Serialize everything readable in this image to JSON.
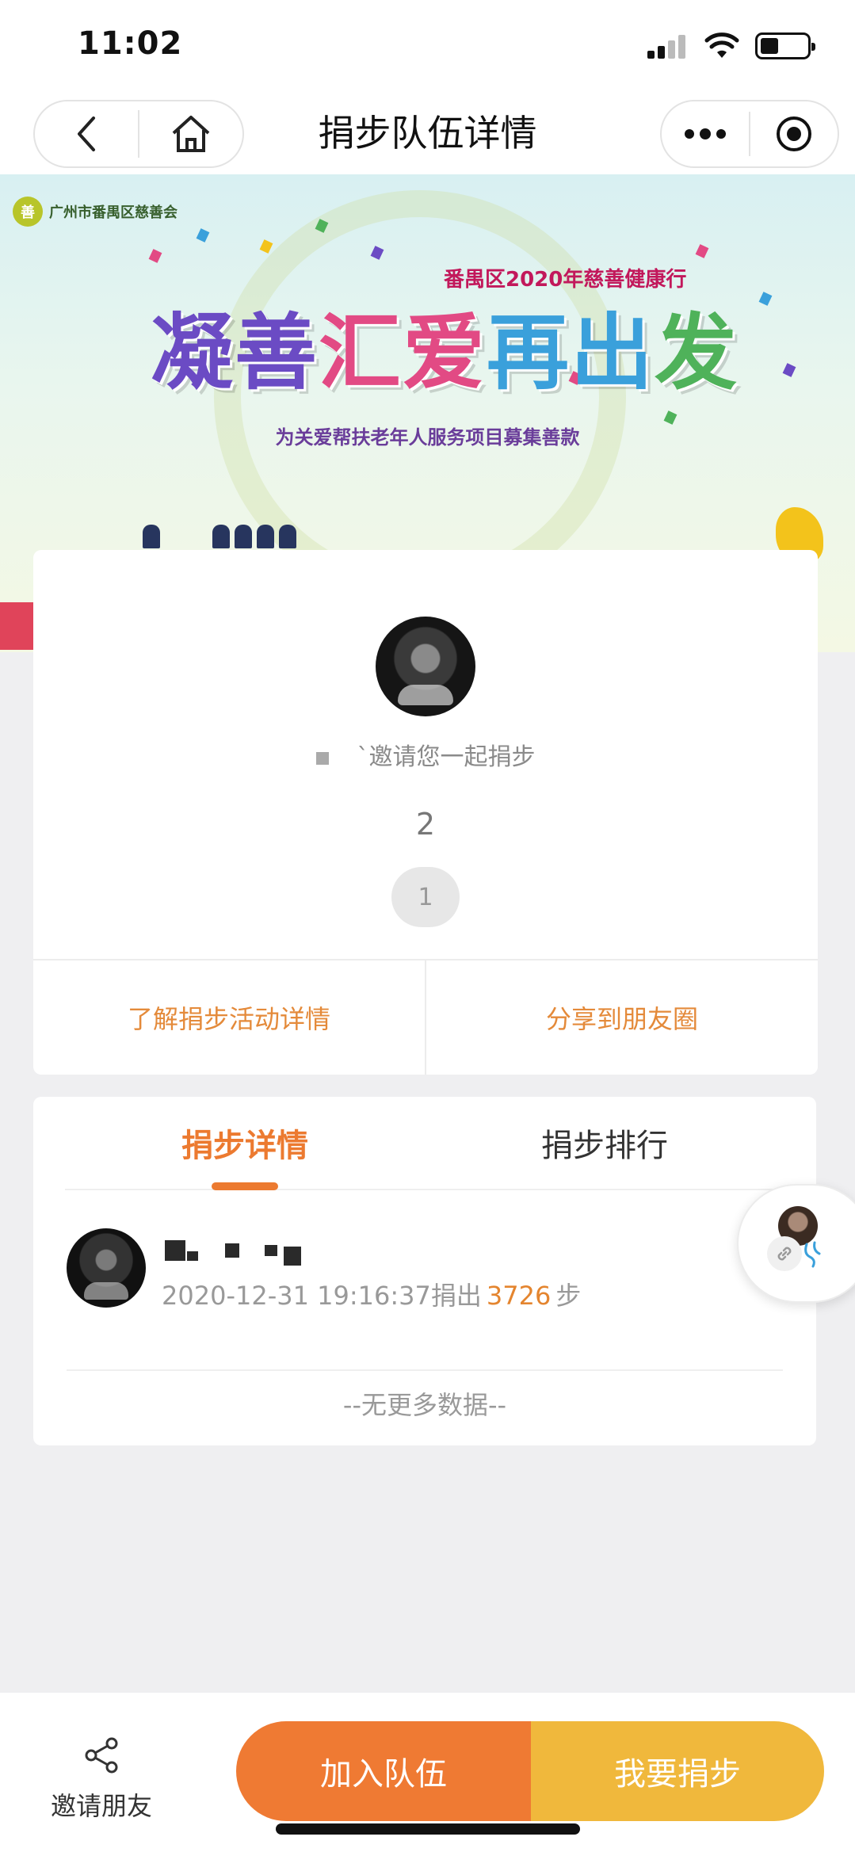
{
  "status_bar": {
    "time": "11:02"
  },
  "nav": {
    "title": "捐步队伍详情"
  },
  "banner": {
    "org_name": "广州市番禺区慈善会",
    "subtitle": "番禺区2020年慈善健康行",
    "headline_1": "凝善",
    "headline_2": "汇爱",
    "headline_3": "再出",
    "headline_4": "发",
    "caption": "为关爱帮扶老年人服务项目募集善款"
  },
  "team": {
    "invite_text": "`邀请您一起捐步",
    "count": "2",
    "member_count": "1"
  },
  "card_actions": {
    "learn_more": "了解捐步活动详情",
    "share_moments": "分享到朋友圈"
  },
  "tabs": [
    {
      "label": "捐步详情",
      "active": true
    },
    {
      "label": "捐步排行",
      "active": false
    }
  ],
  "records": [
    {
      "datetime": "2020-12-31 19:16:37",
      "action": "捐出",
      "steps": "3726",
      "unit": "步"
    }
  ],
  "list_footer": "--无更多数据--",
  "bottom_bar": {
    "invite_friends": "邀请朋友",
    "join_team": "加入队伍",
    "donate_steps": "我要捐步"
  },
  "colors": {
    "accent_orange": "#ec7a30",
    "accent_yellow": "#f0b83c",
    "link_orange": "#e48a3a",
    "background": "#efeff1"
  },
  "icons": [
    "back-icon",
    "home-icon",
    "more-icon",
    "target-icon",
    "share-icon",
    "link-icon",
    "signal-icon",
    "wifi-icon",
    "battery-icon"
  ]
}
